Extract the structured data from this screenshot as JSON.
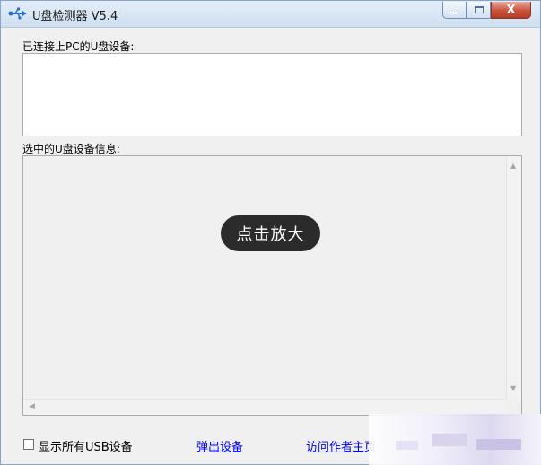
{
  "window": {
    "title": "U盘检测器 V5.4",
    "caption": {
      "minimize_icon": "minimize-icon",
      "maximize_icon": "maximize-icon",
      "close_label": "X"
    }
  },
  "connected": {
    "label": "已连接上PC的U盘设备:",
    "items": []
  },
  "selected_info": {
    "label": "选中的U盘设备信息:",
    "content": ""
  },
  "overlay": {
    "zoom_label": "点击放大"
  },
  "footer": {
    "show_all_label": "显示所有USB设备",
    "show_all_checked": false,
    "eject_link": "弹出设备",
    "author_link": "访问作者主页"
  },
  "colors": {
    "link": "#0000ee",
    "titlebar_top": "#e3edf8",
    "close_button": "#c9523b",
    "pill": "#2b2b2b"
  }
}
